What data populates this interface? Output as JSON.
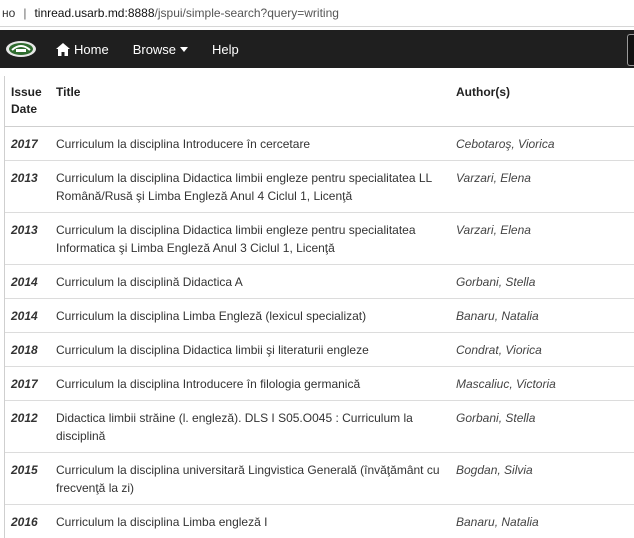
{
  "browser": {
    "address_prefix": "но",
    "url_domain": "tinread.usarb.md:8888",
    "url_rest": "/jspui/simple-search?query=writing"
  },
  "navbar": {
    "home_label": "Home",
    "browse_label": "Browse",
    "help_label": "Help"
  },
  "table": {
    "headers": {
      "issue_date": "Issue Date",
      "title": "Title",
      "authors": "Author(s)"
    },
    "rows": [
      {
        "date": "2017",
        "title": "Curriculum la disciplina Introducere în cercetare",
        "author": "Cebotaroş, Viorica"
      },
      {
        "date": "2013",
        "title": "Curriculum la disciplina Didactica limbii engleze pentru specialitatea LL Română/Rusă şi Limba Engleză Anul 4 Ciclul 1, Licenţă",
        "author": "Varzari, Elena"
      },
      {
        "date": "2013",
        "title": "Curriculum la disciplina Didactica limbii engleze pentru specialitatea Informatica şi Limba Engleză Anul 3 Ciclul 1, Licenţă",
        "author": "Varzari, Elena"
      },
      {
        "date": "2014",
        "title": "Curriculum la disciplină Didactica A",
        "author": "Gorbani, Stella"
      },
      {
        "date": "2014",
        "title": "Curriculum la disciplina Limba Engleză (lexicul specializat)",
        "author": "Banaru, Natalia"
      },
      {
        "date": "2018",
        "title": "Curriculum la disciplina Didactica limbii şi literaturii engleze",
        "author": "Condrat, Viorica"
      },
      {
        "date": "2017",
        "title": "Curriculum la disciplina Introducere în filologia germanică",
        "author": "Mascaliuc, Victoria"
      },
      {
        "date": "2012",
        "title": "Didactica limbii străine (l. engleză). DLS I S05.O045 : Curriculum la disciplină",
        "author": "Gorbani, Stella"
      },
      {
        "date": "2015",
        "title": "Curriculum la disciplina universitară Lingvistica Generală (învăţământ cu frecvenţă la zi)",
        "author": "Bogdan, Silvia"
      },
      {
        "date": "2016",
        "title": "Curriculum la disciplina Limba engleză I",
        "author": "Banaru, Natalia"
      }
    ]
  }
}
